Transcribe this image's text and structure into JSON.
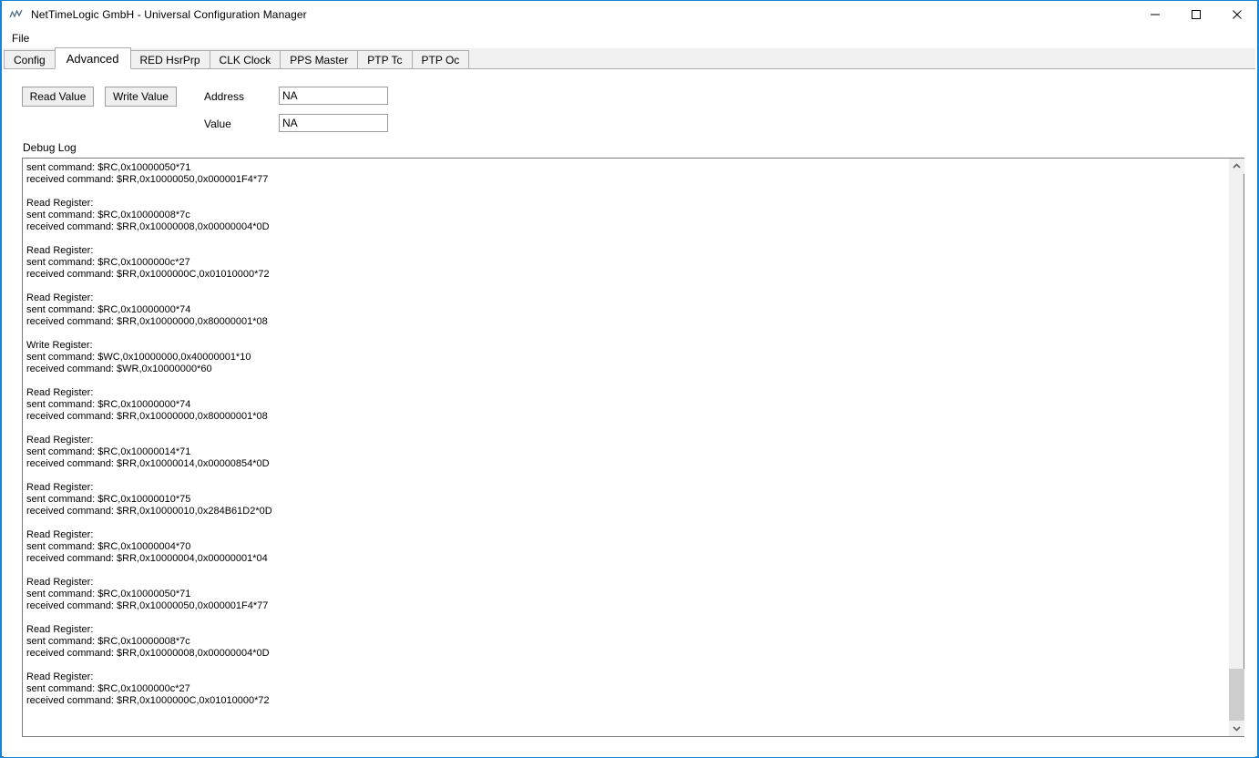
{
  "window": {
    "title": "NetTimeLogic GmbH - Universal Configuration Manager",
    "icon": "waveform-icon",
    "controls": {
      "minimize": "minimize-icon",
      "maximize": "maximize-icon",
      "close": "close-icon"
    },
    "accent_color": "#1683d8"
  },
  "menubar": {
    "items": [
      {
        "label": "File"
      }
    ]
  },
  "tabs": [
    {
      "label": "Config",
      "selected": false
    },
    {
      "label": "Advanced",
      "selected": true
    },
    {
      "label": "RED HsrPrp",
      "selected": false
    },
    {
      "label": "CLK Clock",
      "selected": false
    },
    {
      "label": "PPS Master",
      "selected": false
    },
    {
      "label": "PTP Tc",
      "selected": false
    },
    {
      "label": "PTP Oc",
      "selected": false
    }
  ],
  "toolbar": {
    "read_label": "Read Value",
    "write_label": "Write Value",
    "address_label": "Address",
    "value_label": "Value",
    "address_value": "NA",
    "value_value": "NA"
  },
  "debug": {
    "section_label": "Debug Log",
    "lines": [
      "sent command: $RC,0x10000050*71",
      "received command: $RR,0x10000050,0x000001F4*77",
      "",
      "Read Register:",
      "sent command: $RC,0x10000008*7c",
      "received command: $RR,0x10000008,0x00000004*0D",
      "",
      "Read Register:",
      "sent command: $RC,0x1000000c*27",
      "received command: $RR,0x1000000C,0x01010000*72",
      "",
      "Read Register:",
      "sent command: $RC,0x10000000*74",
      "received command: $RR,0x10000000,0x80000001*08",
      "",
      "Write Register:",
      "sent command: $WC,0x10000000,0x40000001*10",
      "received command: $WR,0x10000000*60",
      "",
      "Read Register:",
      "sent command: $RC,0x10000000*74",
      "received command: $RR,0x10000000,0x80000001*08",
      "",
      "Read Register:",
      "sent command: $RC,0x10000014*71",
      "received command: $RR,0x10000014,0x00000854*0D",
      "",
      "Read Register:",
      "sent command: $RC,0x10000010*75",
      "received command: $RR,0x10000010,0x284B61D2*0D",
      "",
      "Read Register:",
      "sent command: $RC,0x10000004*70",
      "received command: $RR,0x10000004,0x00000001*04",
      "",
      "Read Register:",
      "sent command: $RC,0x10000050*71",
      "received command: $RR,0x10000050,0x000001F4*77",
      "",
      "Read Register:",
      "sent command: $RC,0x10000008*7c",
      "received command: $RR,0x10000008,0x00000004*0D",
      "",
      "Read Register:",
      "sent command: $RC,0x1000000c*27",
      "received command: $RR,0x1000000C,0x01010000*72"
    ]
  },
  "scrollbar": {
    "up_icon": "chevron-up-icon",
    "down_icon": "chevron-down-icon",
    "thumb_position": "bottom"
  }
}
